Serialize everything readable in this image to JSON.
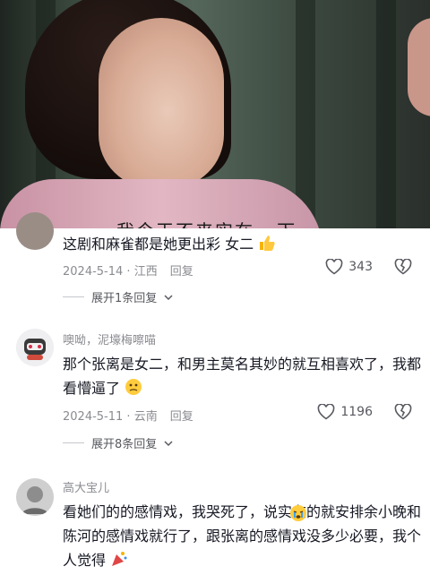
{
  "video": {
    "subtitle": "我今天不来实在...下"
  },
  "comments": [
    {
      "username": "",
      "text": "这剧和麻雀都是她更出彩 女二",
      "emoji": "thumbs-up",
      "date": "2024-5-14",
      "location": "江西",
      "reply_label": "回复",
      "likes": "343",
      "expand_label": "展开1条回复"
    },
    {
      "username": "噢呦，泥壕梅嚓喵",
      "text": "那个张离是女二，和男主莫名其妙的就互相喜欢了，我都看懵逼了",
      "emoji": "confused-face",
      "date": "2024-5-11",
      "location": "云南",
      "reply_label": "回复",
      "likes": "1196",
      "expand_label": "展开8条回复"
    },
    {
      "username": "高大宝儿",
      "text": "看她们的的感情戏，我哭死了，说实在的就安排余小晚和陈河的感情戏就行了，跟张离的感情戏没多少必要，我个人觉得",
      "emoji": "crying-face",
      "emoji2": "party-popper"
    }
  ],
  "colors": {
    "text": "#161823",
    "meta": "#8a8b91"
  }
}
